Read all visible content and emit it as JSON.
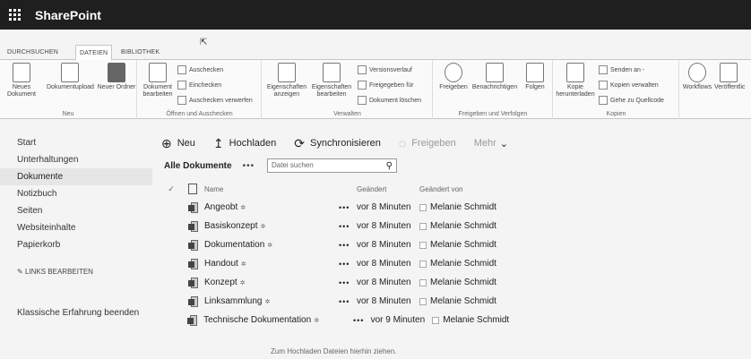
{
  "suite": {
    "brand": "SharePoint"
  },
  "ribbon": {
    "tabs": [
      "DURCHSUCHEN",
      "DATEIEN",
      "BIBLIOTHEK"
    ],
    "groups": {
      "neu": {
        "label": "Neu",
        "buttons": [
          "Neues Dokument",
          "Dokumentupload",
          "Neuer Ordner"
        ]
      },
      "oeffnen": {
        "label": "Öffnen und Auschecken",
        "big": "Dokument bearbeiten",
        "small": [
          "Auschecken",
          "Einchecken",
          "Auschecken verwerfen"
        ]
      },
      "verwalten": {
        "label": "Verwalten",
        "big": [
          "Eigenschaften anzeigen",
          "Eigenschaften bearbeiten"
        ],
        "small": [
          "Versionsverlauf",
          "Freigegeben für",
          "Dokument löschen"
        ]
      },
      "freigeben": {
        "label": "Freigeben und Verfolgen",
        "buttons": [
          "Freigeben",
          "Benachrichtigen",
          "Folgen"
        ]
      },
      "kopien": {
        "label": "Kopien",
        "big": "Kopie herunterladen",
        "small": [
          "Senden an -",
          "Kopien verwalten",
          "Gehe zu Quellcode"
        ]
      },
      "workflows": {
        "buttons": [
          "Workflows",
          "Veröffentlic"
        ]
      }
    }
  },
  "nav": {
    "items": [
      "Start",
      "Unterhaltungen",
      "Dokumente",
      "Notizbuch",
      "Seiten",
      "Websiteinhalte",
      "Papierkorb"
    ],
    "selected": "Dokumente",
    "edit_links": "LINKS BEARBEITEN",
    "classic": "Klassische Erfahrung beenden"
  },
  "commands": {
    "new": "Neu",
    "upload": "Hochladen",
    "sync": "Synchronisieren",
    "share": "Freigeben",
    "more": "Mehr"
  },
  "library": {
    "view": "Alle Dokumente",
    "more": "•••",
    "search_placeholder": "Datei suchen",
    "columns": {
      "name": "Name",
      "modified": "Geändert",
      "modified_by": "Geändert von"
    },
    "rows": [
      {
        "name": "Angeobt",
        "modified": "vor 8 Minuten",
        "by": "Melanie Schmidt"
      },
      {
        "name": "Basiskonzept",
        "modified": "vor 8 Minuten",
        "by": "Melanie Schmidt"
      },
      {
        "name": "Dokumentation",
        "modified": "vor 8 Minuten",
        "by": "Melanie Schmidt"
      },
      {
        "name": "Handout",
        "modified": "vor 8 Minuten",
        "by": "Melanie Schmidt"
      },
      {
        "name": "Konzept",
        "modified": "vor 8 Minuten",
        "by": "Melanie Schmidt"
      },
      {
        "name": "Linksammlung",
        "modified": "vor 8 Minuten",
        "by": "Melanie Schmidt"
      },
      {
        "name": "Technische Dokumentation",
        "modified": "vor 9 Minuten",
        "by": "Melanie Schmidt"
      }
    ],
    "drop_hint": "Zum Hochladen Dateien hierhin ziehen."
  }
}
